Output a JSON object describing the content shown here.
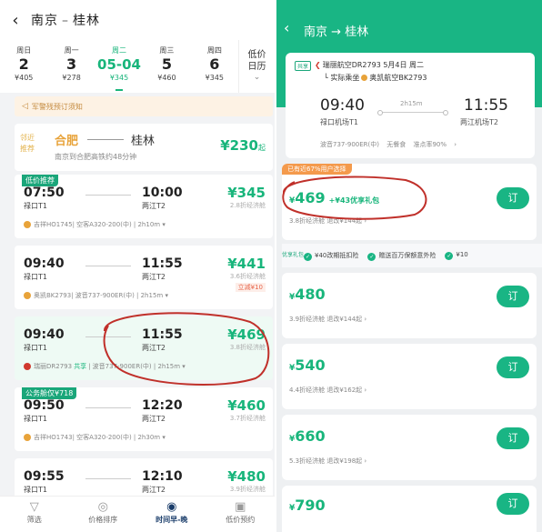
{
  "left": {
    "header": {
      "back_icon": "back-arrow-icon",
      "from": "南京",
      "arrow": "–",
      "to": "桂林"
    },
    "dates": [
      {
        "weekday": "周日",
        "day": "2",
        "price": "¥405",
        "active": false
      },
      {
        "weekday": "周一",
        "day": "3",
        "price": "¥278",
        "active": false
      },
      {
        "weekday": "周二",
        "day": "05-04",
        "price": "¥345",
        "active": true
      },
      {
        "weekday": "周三",
        "day": "5",
        "price": "¥460",
        "active": false
      },
      {
        "weekday": "周四",
        "day": "6",
        "price": "¥345",
        "active": false
      }
    ],
    "lowcal": {
      "line1": "低价",
      "line2": "日历",
      "chev": "⌄"
    },
    "notice": "军警残预订须知",
    "recommend": {
      "tag": "邻近推荐",
      "from": "合肥",
      "to": "桂林",
      "sub": "南京到合肥高铁约48分钟",
      "price": "¥230",
      "suffix": "起"
    },
    "flights": [
      {
        "badge": "低价推荐",
        "dep": "07:50",
        "dep_ap": "禄口T1",
        "arr": "10:00",
        "arr_ap": "两江T2",
        "price": "¥345",
        "disc": "2.8折经济舱",
        "red": "",
        "airline": "吉祥HO1745",
        "share": "",
        "meta": "| 空客A320-200(中) | 2h10m ▾",
        "red_logo": false
      },
      {
        "badge": "",
        "dep": "09:40",
        "dep_ap": "禄口T1",
        "arr": "11:55",
        "arr_ap": "两江T2",
        "price": "¥441",
        "disc": "3.6折经济舱",
        "red": "立减¥10",
        "airline": "奥凯BK2793",
        "share": "",
        "meta": "| 波音737-900ER(中) | 2h15m ▾",
        "red_logo": false
      },
      {
        "badge": "",
        "dep": "09:40",
        "dep_ap": "禄口T1",
        "arr": "11:55",
        "arr_ap": "两江T2",
        "price": "¥469",
        "disc": "3.8折经济舱",
        "red": "",
        "airline": "瑞丽DR2793",
        "share": "共享",
        "meta": "| 波音737-900ER(中) | 2h15m ▾",
        "red_logo": true
      },
      {
        "badge": "公务舱仅¥718",
        "dep": "09:50",
        "dep_ap": "禄口T1",
        "arr": "12:20",
        "arr_ap": "两江T2",
        "price": "¥460",
        "disc": "3.7折经济舱",
        "red": "",
        "airline": "吉祥HO1743",
        "share": "",
        "meta": "| 空客A320-200(中) | 2h30m ▾",
        "red_logo": false
      },
      {
        "badge": "",
        "dep": "09:55",
        "dep_ap": "禄口T1",
        "arr": "12:10",
        "arr_ap": "两江T2",
        "price": "¥480",
        "disc": "3.9折经济舱",
        "red": "",
        "airline": "",
        "share": "",
        "meta": "",
        "red_logo": false
      }
    ],
    "tabs": [
      {
        "icon": "filter-icon",
        "glyph": "▽",
        "label": "筛选",
        "on": false
      },
      {
        "icon": "price-sort-icon",
        "glyph": "◎",
        "label": "价格排序",
        "on": false
      },
      {
        "icon": "time-sort-icon",
        "glyph": "◉",
        "label": "时间早-晚",
        "on": true
      },
      {
        "icon": "price-alert-icon",
        "glyph": "▣",
        "label": "低价预约",
        "on": false
      }
    ]
  },
  "right": {
    "header": {
      "from": "南京",
      "arrow": "→",
      "to": "桂林"
    },
    "info": {
      "chip": "共享",
      "flight": "瑞丽航空DR2793 5月4日 周二",
      "operator_prefix": "└ 实际乘坐",
      "operator": "奥凯航空BK2793",
      "dep": "09:40",
      "dep_ap": "禄口机场T1",
      "duration": "2h15m",
      "arr": "11:55",
      "arr_ap": "两江机场T2",
      "footer": "波音737-900ER(中) 无餐食 准点率90% ›"
    },
    "best_tag": "已有近67%用户选择",
    "offers": [
      {
        "price": "469",
        "gift": "+¥43优享礼包",
        "desc": "3.8折经济舱 退改¥144起 ›",
        "book": "订"
      },
      {
        "price": "480",
        "gift": "",
        "desc": "3.9折经济舱 退改¥144起 ›",
        "book": "订"
      },
      {
        "price": "540",
        "gift": "",
        "desc": "4.4折经济舱 退改¥162起 ›",
        "book": "订"
      },
      {
        "price": "660",
        "gift": "",
        "desc": "5.3折经济舱 退改¥198起 ›",
        "book": "订"
      },
      {
        "price": "790",
        "gift": "",
        "desc": "",
        "book": "订"
      }
    ],
    "perks_label": "优享礼包",
    "perks": [
      "¥40改期抵扣险",
      "赠送百万保额意外险",
      "¥10"
    ],
    "currency": "¥"
  },
  "colors": {
    "accent": "#19b584",
    "annotation": "#c0302a"
  }
}
